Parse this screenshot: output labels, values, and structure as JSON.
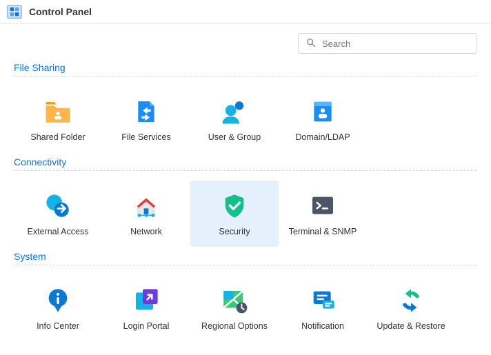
{
  "window": {
    "title": "Control Panel"
  },
  "search": {
    "placeholder": "Search"
  },
  "sections": {
    "file_sharing": {
      "title": "File Sharing",
      "items": {
        "shared_folder": "Shared Folder",
        "file_services": "File Services",
        "user_group": "User & Group",
        "domain_ldap": "Domain/LDAP"
      }
    },
    "connectivity": {
      "title": "Connectivity",
      "items": {
        "external_access": "External Access",
        "network": "Network",
        "security": "Security",
        "terminal_snmp": "Terminal & SNMP"
      }
    },
    "system": {
      "title": "System",
      "items": {
        "info_center": "Info Center",
        "login_portal": "Login Portal",
        "regional_options": "Regional Options",
        "notification": "Notification",
        "update_restore": "Update & Restore"
      }
    }
  },
  "selected_item": "security"
}
